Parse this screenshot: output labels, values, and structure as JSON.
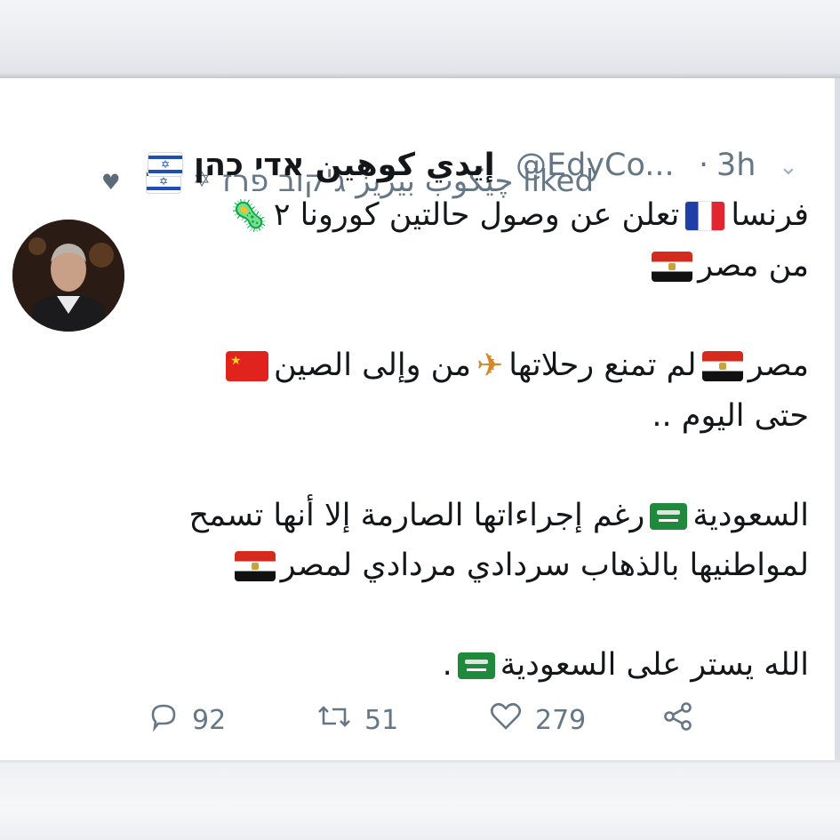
{
  "liked_row": {
    "text": "چيکوب بيريز ג'קוב פרז liked",
    "star_glyph": "✡",
    "heart_icon": "heart-filled-icon"
  },
  "tweet": {
    "display_name": "إيدي كوهين אדי כהן",
    "handle": "@EdyCo...",
    "separator": "·",
    "time": "3h",
    "lines": [
      "فرنسا",
      "تعلن عن وصول حالتين كورونا ٢",
      "من مصر",
      "مصر",
      "لم تمنع رحلاتها",
      "من وإلى الصين",
      "حتى اليوم ..",
      "السعودية",
      "رغم إجراءاتها الصارمة إلا أنها تسمح",
      "لمواطنيها بالذهاب سردادي مردادي لمصر",
      "الله يستر على السعودية",
      "."
    ]
  },
  "actions": {
    "replies": "92",
    "retweets": "51",
    "likes": "279"
  },
  "colors": {
    "text": "#14171a",
    "muted": "#657786",
    "divider": "#e1e4e8"
  }
}
